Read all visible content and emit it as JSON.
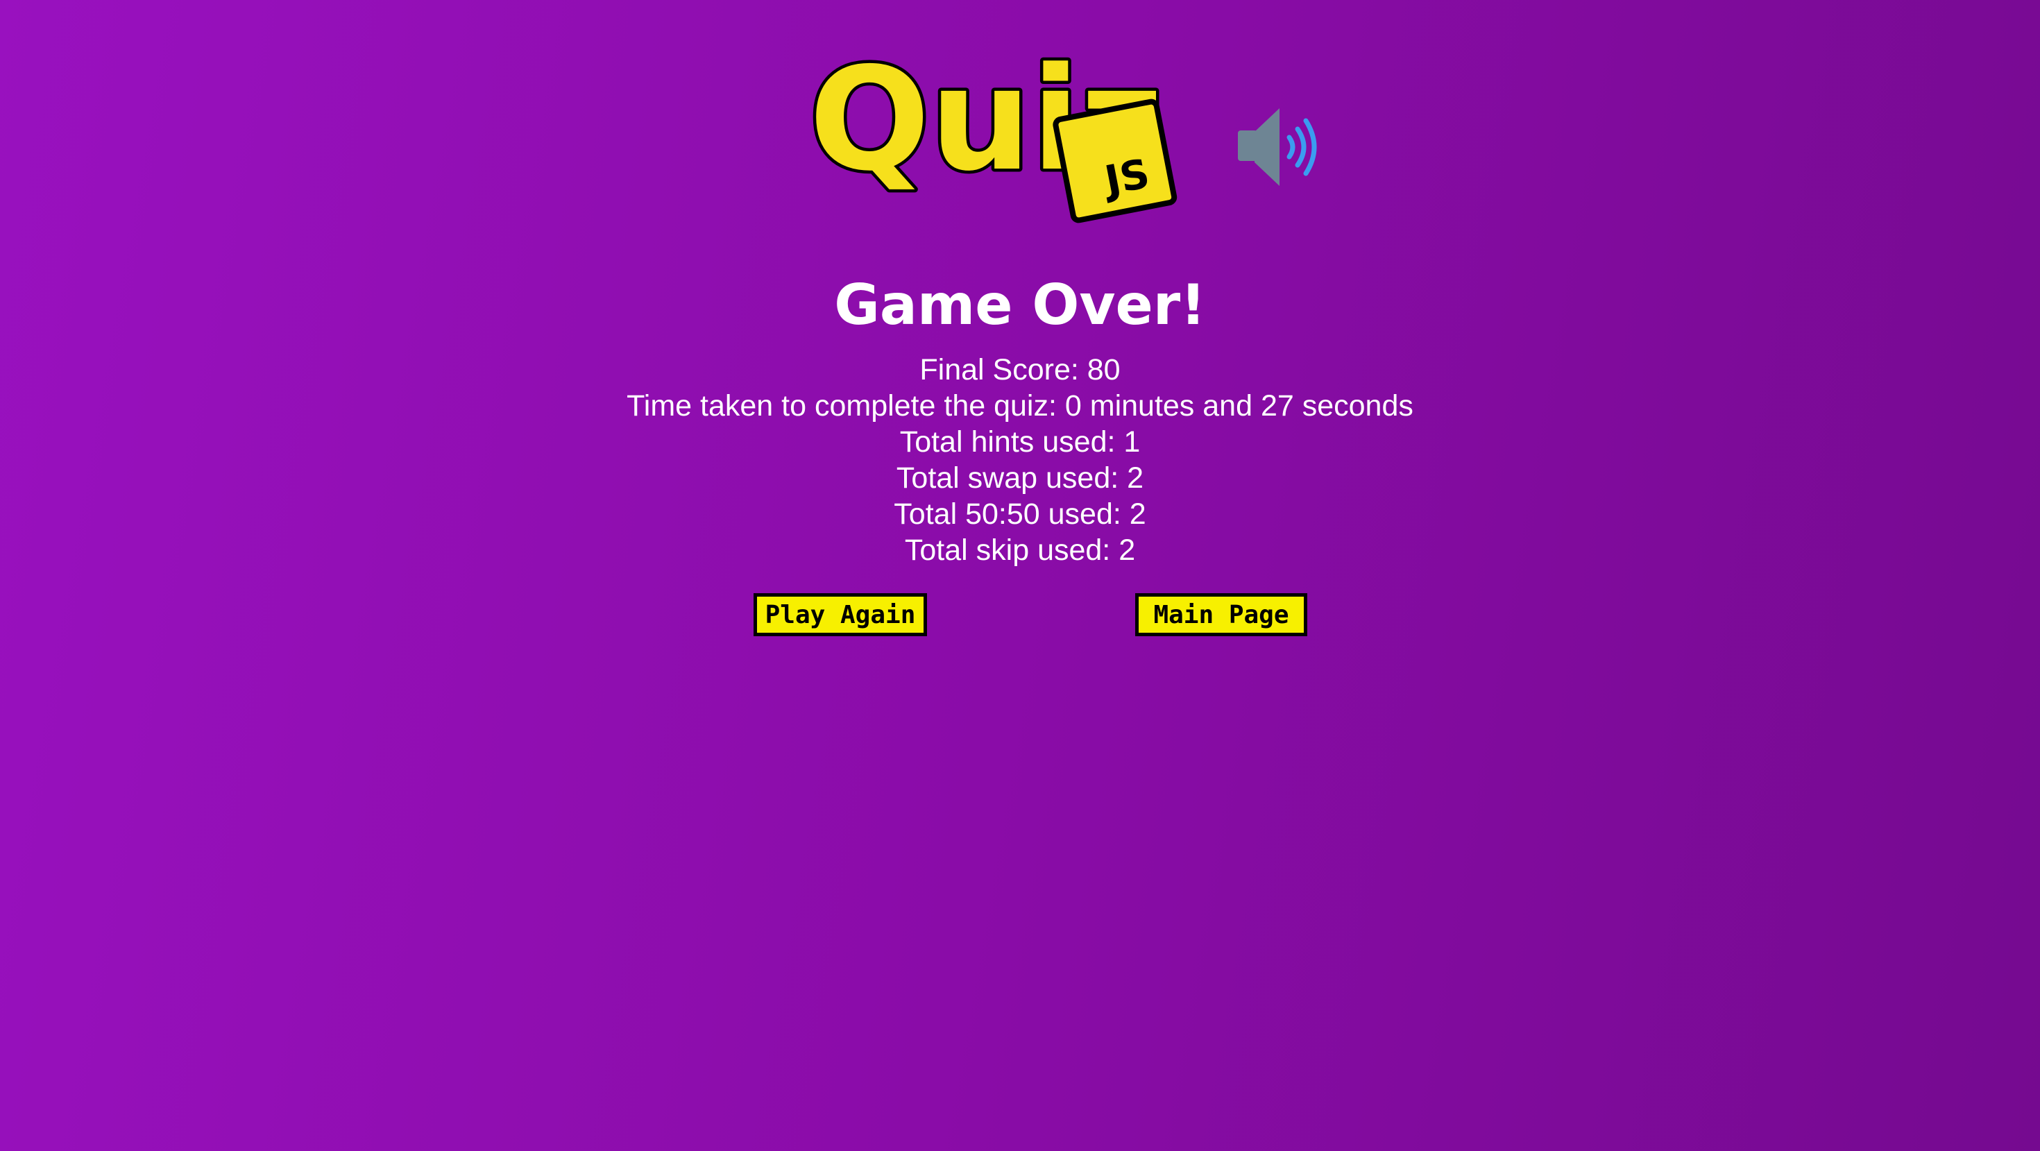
{
  "logo": {
    "word": "Quiz",
    "badge": "JS",
    "accent": "#f6e01c",
    "outline": "#000000"
  },
  "sound_toggle": {
    "icon": "speaker-on-icon",
    "wave_color": "#3b9cf0",
    "body_color": "#6e8594"
  },
  "game_over": {
    "title": "Game Over!",
    "stats": [
      "Final Score: 80",
      "Time taken to complete the quiz: 0 minutes and 27 seconds",
      "Total hints used: 1",
      "Total swap used: 2",
      "Total 50:50 used: 2",
      "Total skip used: 2"
    ]
  },
  "buttons": {
    "play_again": "Play Again",
    "main_page": "Main Page",
    "color": "#f7f000"
  },
  "colors": {
    "background_start": "#9911bf",
    "background_end": "#750a90",
    "text": "#ffffff"
  }
}
